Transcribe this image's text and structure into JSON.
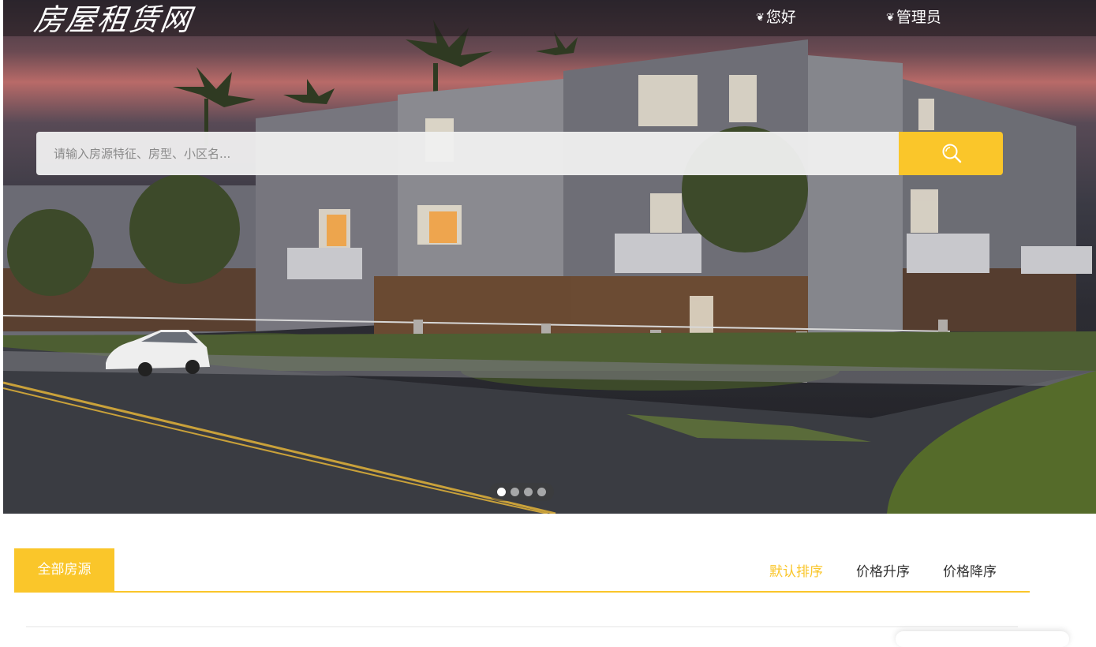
{
  "site": {
    "logo": "房屋租赁网"
  },
  "nav": {
    "hello_icon": "palm-icon",
    "hello": "您好",
    "admin_icon": "palm-icon",
    "admin": "管理员"
  },
  "search": {
    "placeholder": "请输入房源特征、房型、小区名...",
    "button_icon": "search-icon"
  },
  "carousel": {
    "slide_count": 4,
    "active_index": 0
  },
  "listing": {
    "tab_all": "全部房源",
    "sort": {
      "default": "默认排序",
      "price_asc": "价格升序",
      "price_desc": "价格降序"
    }
  },
  "colors": {
    "accent": "#fac62a",
    "text": "#333333"
  }
}
